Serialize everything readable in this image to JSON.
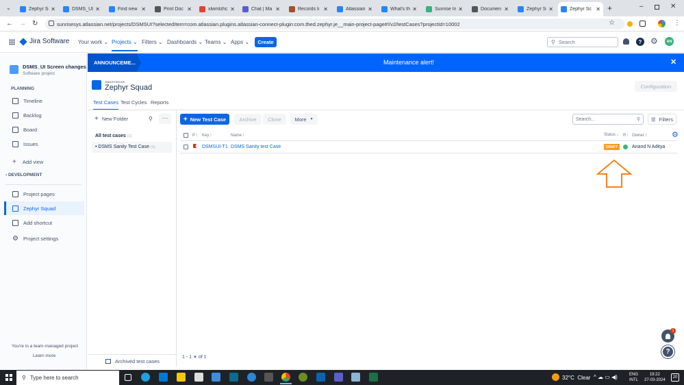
{
  "browser": {
    "tabs": [
      {
        "title": "Zephyr Sc",
        "color": "#2684ff"
      },
      {
        "title": "DSMS_UI",
        "color": "#2684ff"
      },
      {
        "title": "Find new",
        "color": "#2684ff"
      },
      {
        "title": "Print Doc",
        "color": "#555555"
      },
      {
        "title": "xlwmlzhc",
        "color": "#e34234"
      },
      {
        "title": "Chat | Ma",
        "color": "#5b5fc7"
      },
      {
        "title": "Records li",
        "color": "#a0522d"
      },
      {
        "title": "Atlassian",
        "color": "#2684ff"
      },
      {
        "title": "What's the",
        "color": "#2684ff"
      },
      {
        "title": "Sunrise Ini",
        "color": "#36b37e"
      },
      {
        "title": "Documen",
        "color": "#555555"
      },
      {
        "title": "Zephyr Sc",
        "color": "#2684ff"
      },
      {
        "title": "Zephyr Sc",
        "color": "#2684ff",
        "active": true
      }
    ],
    "url": "sunrisesys.atlassian.net/projects/DSMSUI?selectedItem=com.atlassian.plugins.atlassian-connect-plugin:com.thed.zephyr.je__main-project-page#!/v2/testCases?projectId=10002"
  },
  "topnav": {
    "brand": "Jira Software",
    "items": [
      "Your work",
      "Projects",
      "Filters",
      "Dashboards",
      "Teams",
      "Apps"
    ],
    "create": "Create",
    "search_placeholder": "Search",
    "avatar_initials": "AN"
  },
  "sidebar": {
    "project_name": "DSMS_UI Screen changes",
    "project_type": "Software project",
    "planning_label": "PLANNING",
    "planning_items": [
      "Timeline",
      "Backlog",
      "Board",
      "Issues"
    ],
    "add_view": "Add view",
    "development_label": "DEVELOPMENT",
    "bottom_items": [
      "Project pages",
      "Zephyr Squad",
      "Add shortcut",
      "Project settings"
    ],
    "footer_text": "You're in a team-managed project",
    "learn_more": "Learn more"
  },
  "banner": {
    "tag": "ANNOUNCEME...",
    "message": "Maintenance alert!"
  },
  "zephyr": {
    "vendor": "SMARTBEAR",
    "title": "Zephyr Squad",
    "configuration": "Configuration",
    "tabs": [
      "Test Cases",
      "Test Cycles",
      "Reports"
    ],
    "new_folder": "New Folder",
    "all_test_cases": "All test cases",
    "all_count": "(1)",
    "folder_item": "DSMS Sanity Test Case",
    "folder_count": "(1)",
    "archived": "Archived test cases",
    "new_test_case": "New Test Case",
    "archive": "Archive",
    "clone": "Clone",
    "more": "More",
    "search_placeholder": "Search...",
    "filters": "Filters",
    "columns": {
      "p": "P",
      "key": "Key",
      "name": "Name",
      "status": "Status",
      "r": "R",
      "owner": "Owner"
    },
    "rows": [
      {
        "key": "DSMSUI-T1",
        "name": "DSMS Sanity test Case",
        "status": "DRAFT",
        "owner": "Anand N Aditya"
      }
    ],
    "pagination": "1 - 1",
    "pagination_of": "of 1",
    "notification_count": "1"
  },
  "taskbar": {
    "search_placeholder": "Type here to search",
    "weather": "32°C  Clear",
    "lang1": "ENG",
    "lang2": "INTL",
    "time": "19:22",
    "date": "27-03-2024",
    "notif": "20"
  },
  "colors": {
    "brand_blue": "#0c66e4",
    "banner_blue": "#0065ff",
    "draft_orange": "#ff991f",
    "arrow_orange": "#f5821f"
  }
}
